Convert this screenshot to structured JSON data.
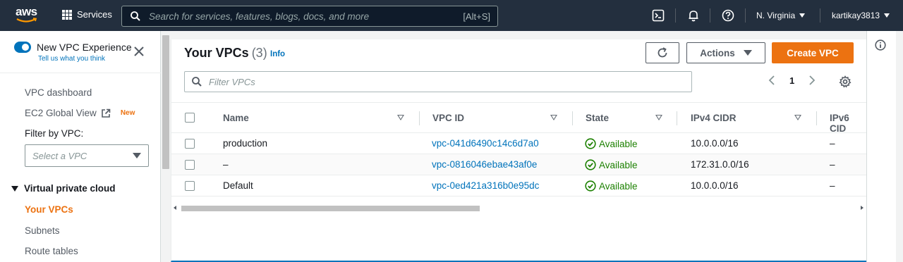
{
  "topnav": {
    "logo": "aws",
    "services_label": "Services",
    "search_placeholder": "Search for services, features, blogs, docs, and more",
    "search_shortcut": "[Alt+S]",
    "region": "N. Virginia",
    "user": "kartikay3813",
    "icons": [
      "grid-icon",
      "search-icon",
      "cloudshell-icon",
      "bell-icon",
      "help-icon"
    ]
  },
  "sidebar": {
    "experience_label": "New VPC Experience",
    "experience_link": "Tell us what you think",
    "items": [
      {
        "label": "VPC dashboard"
      },
      {
        "label": "EC2 Global View",
        "badge": "New"
      }
    ],
    "filter_label": "Filter by VPC:",
    "filter_placeholder": "Select a VPC",
    "section": "Virtual private cloud",
    "section_items": [
      {
        "label": "Your VPCs",
        "active": true
      },
      {
        "label": "Subnets"
      },
      {
        "label": "Route tables"
      }
    ]
  },
  "main": {
    "title": "Your VPCs",
    "count": "(3)",
    "info": "Info",
    "actions_label": "Actions",
    "create_label": "Create VPC",
    "filter_placeholder": "Filter VPCs",
    "page": "1",
    "columns": [
      "Name",
      "VPC ID",
      "State",
      "IPv4 CIDR",
      "IPv6 CID"
    ],
    "rows": [
      {
        "name": "production",
        "vpc_id": "vpc-041d6490c14c6d7a0",
        "state": "Available",
        "ipv4": "10.0.0.0/16",
        "ipv6": "–"
      },
      {
        "name": "–",
        "vpc_id": "vpc-0816046ebae43af0e",
        "state": "Available",
        "ipv4": "172.31.0.0/16",
        "ipv6": "–"
      },
      {
        "name": "Default",
        "vpc_id": "vpc-0ed421a316b0e95dc",
        "state": "Available",
        "ipv4": "10.0.0.0/16",
        "ipv6": "–"
      }
    ]
  },
  "colors": {
    "nav_bg": "#232f3e",
    "accent_orange": "#ec7211",
    "link_blue": "#0073bb",
    "success_green": "#1d8102"
  }
}
